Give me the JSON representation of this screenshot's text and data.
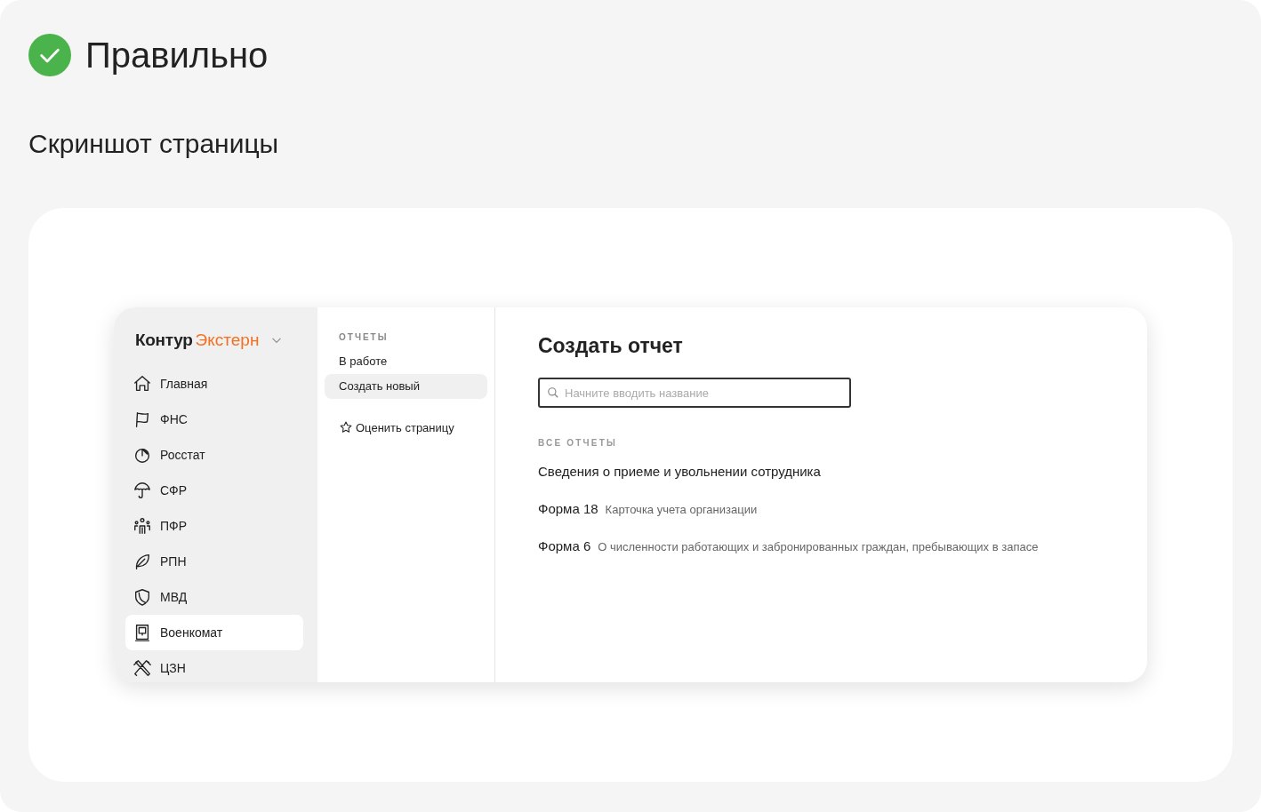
{
  "header": {
    "title": "Правильно",
    "subtitle": "Скриншот страницы"
  },
  "sidebar": {
    "logo": {
      "brand": "Контур",
      "product": "Экстерн"
    },
    "items": [
      {
        "label": "Главная",
        "selected": false
      },
      {
        "label": "ФНС",
        "selected": false
      },
      {
        "label": "Росстат",
        "selected": false
      },
      {
        "label": "СФР",
        "selected": false
      },
      {
        "label": "ПФР",
        "selected": false
      },
      {
        "label": "РПН",
        "selected": false
      },
      {
        "label": "МВД",
        "selected": false
      },
      {
        "label": "Военкомат",
        "selected": true
      },
      {
        "label": "ЦЗН",
        "selected": false
      }
    ]
  },
  "submenu": {
    "heading": "ОТЧЕТЫ",
    "items": [
      {
        "label": "В работе",
        "selected": false
      },
      {
        "label": "Создать новый",
        "selected": true
      }
    ],
    "rate_link": "Оценить страницу"
  },
  "main": {
    "title": "Создать отчет",
    "search": {
      "placeholder": "Начните вводить название"
    },
    "section_heading": "ВСЕ ОТЧЕТЫ",
    "reports": [
      {
        "name": "Сведения о приеме и увольнении сотрудника"
      },
      {
        "name": "Форма 18",
        "description": "Карточка учета организации"
      },
      {
        "name": "Форма 6",
        "description": "О численности работающих и забронированных граждан, пребывающих в запасе"
      }
    ]
  }
}
